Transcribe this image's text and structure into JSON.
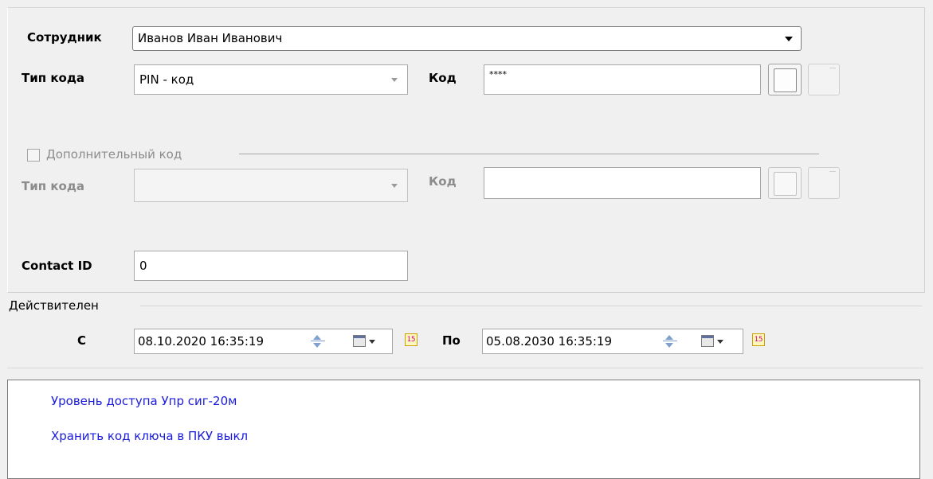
{
  "employee": {
    "label": "Сотрудник",
    "value": "Иванов Иван Иванович"
  },
  "code_type": {
    "label": "Тип кода",
    "value": "PIN - код"
  },
  "code": {
    "label": "Код",
    "value": "****"
  },
  "additional": {
    "checkbox_label": "Дополнительный код",
    "checked": false,
    "code_type_label": "Тип кода",
    "code_type_value": "",
    "code_label": "Код",
    "code_value": ""
  },
  "contact_id": {
    "label": "Contact ID",
    "value": "0"
  },
  "valid": {
    "group_label": "Действителен",
    "from_label": "С",
    "from_value": "08.10.2020 16:35:19",
    "to_label": "По",
    "to_value": "05.08.2030 16:35:19",
    "calendar_day": "15"
  },
  "info": {
    "lines": [
      "Уровень доступа  Упр сиг-20м",
      "Хранить код ключа в ПКУ  выкл"
    ]
  },
  "colors": {
    "info_text": "#1a1adc",
    "disabled_text": "#8c8c8c",
    "spinner": "#7f9fcf"
  }
}
